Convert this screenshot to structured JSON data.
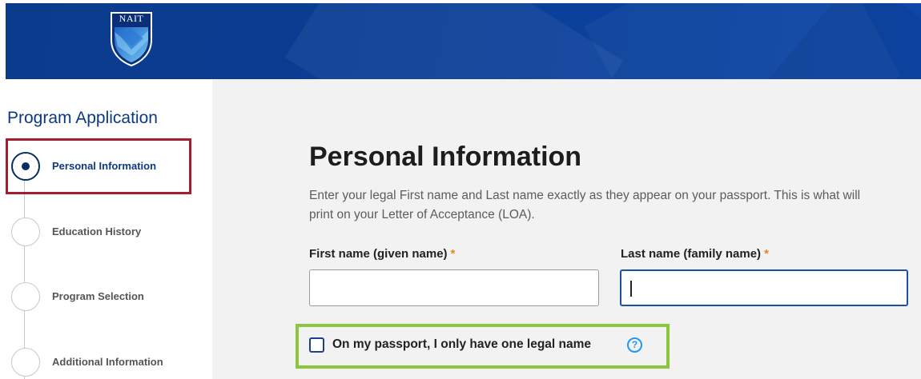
{
  "header": {
    "logo_text": "NAIT"
  },
  "sidebar": {
    "title": "Program Application",
    "steps": [
      {
        "label": "Personal Information",
        "state": "current"
      },
      {
        "label": "Education History",
        "state": "pending"
      },
      {
        "label": "Program Selection",
        "state": "pending"
      },
      {
        "label": "Additional Information",
        "state": "pending"
      }
    ]
  },
  "main": {
    "title": "Personal Information",
    "description": "Enter your legal First name and Last name exactly as they appear on your passport. This is what will print on your Letter of Acceptance (LOA).",
    "fields": {
      "first_name": {
        "label": "First name (given name)",
        "required_mark": "*",
        "value": ""
      },
      "last_name": {
        "label": "Last name (family name)",
        "required_mark": "*",
        "value": ""
      }
    },
    "one_name_checkbox": {
      "label": "On my passport, I only have one legal name",
      "checked": false,
      "help_icon": "?"
    }
  },
  "colors": {
    "header_blue": "#0b3b8c",
    "title_navy": "#0c3a7e",
    "required_orange": "#e08a1a",
    "red_highlight": "#a51d2d",
    "green_highlight": "#8cc63f",
    "help_blue": "#2196f3"
  }
}
